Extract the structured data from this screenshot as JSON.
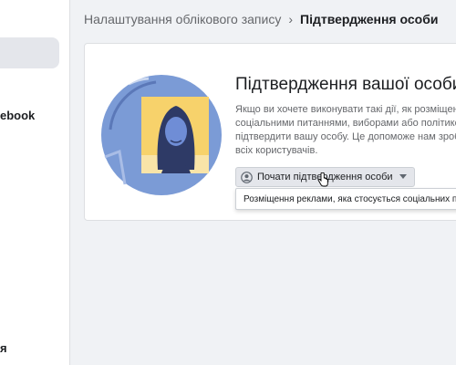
{
  "sidebar": {
    "item_label_1": "ebook",
    "item_label_2": "я"
  },
  "breadcrumb": {
    "parent": "Налаштування облікового запису",
    "separator": "›",
    "current": "Підтвердження особи"
  },
  "card": {
    "title": "Підтвердження вашої особи",
    "description_lines": [
      "Якщо ви хочете виконувати такі дії, як розміщенн",
      "соціальними питаннями, виборами або політико",
      "підтвердити вашу особу. Це допоможе нам зробі",
      "всіх користувачів."
    ],
    "button_label": "Почати підтвердження особи",
    "dropdown_option": "Розміщення реклами, яка стосується соціальних питан"
  },
  "icons": {
    "button_icon": "user-circle-icon",
    "button_caret": "caret-down-icon"
  },
  "colors": {
    "background": "#f0f2f5",
    "illustration_circle": "#7b9bd6",
    "illustration_frame": "#f7d26b"
  }
}
